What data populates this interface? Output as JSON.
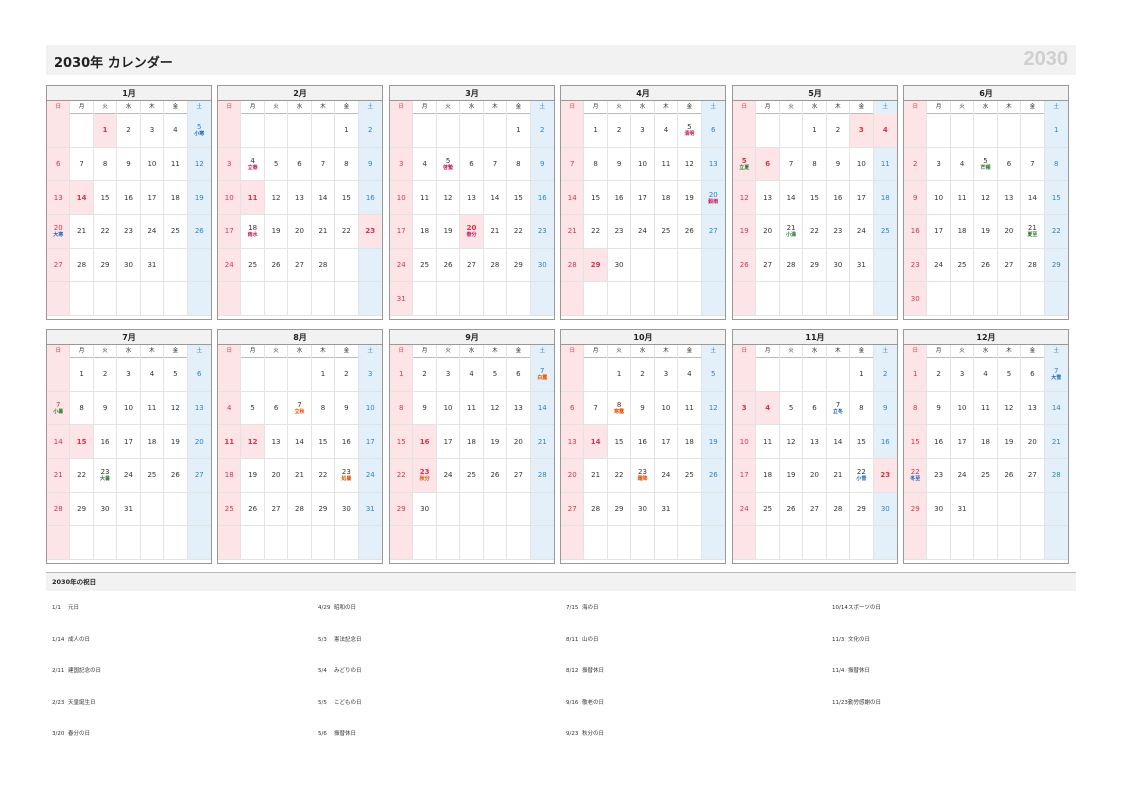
{
  "header": {
    "title": "2030年 カレンダー",
    "year_mark": "2030"
  },
  "weekdays": [
    "日",
    "月",
    "火",
    "水",
    "木",
    "金",
    "土"
  ],
  "colors": {
    "sunday": "#d6334a",
    "saturday": "#2a85c7",
    "holiday_bg": "#fde4e6",
    "saturday_bg": "#e3f0fa",
    "term_green": "#2e7d32",
    "term_orange": "#e65100",
    "term_blue": "#1565c0",
    "term_magenta": "#c2185b"
  },
  "months": [
    {
      "label": "1月",
      "start": 2,
      "days": 31,
      "holidays": [
        1,
        14
      ],
      "terms": {
        "5": {
          "t": "小寒",
          "c": "blue"
        },
        "20": {
          "t": "大寒",
          "c": "blue"
        }
      }
    },
    {
      "label": "2月",
      "start": 5,
      "days": 28,
      "holidays": [
        11,
        23
      ],
      "terms": {
        "4": {
          "t": "立春",
          "c": "magenta"
        },
        "18": {
          "t": "雨水",
          "c": "magenta"
        }
      }
    },
    {
      "label": "3月",
      "start": 5,
      "days": 31,
      "holidays": [
        20
      ],
      "terms": {
        "5": {
          "t": "啓蟄",
          "c": "magenta"
        },
        "20": {
          "t": "春分",
          "c": "magenta"
        }
      }
    },
    {
      "label": "4月",
      "start": 1,
      "days": 30,
      "holidays": [
        29
      ],
      "terms": {
        "5": {
          "t": "清明",
          "c": "magenta"
        },
        "20": {
          "t": "穀雨",
          "c": "magenta"
        }
      }
    },
    {
      "label": "5月",
      "start": 3,
      "days": 31,
      "holidays": [
        3,
        4,
        5,
        6
      ],
      "terms": {
        "5": {
          "t": "立夏",
          "c": "green"
        },
        "21": {
          "t": "小満",
          "c": "green"
        }
      }
    },
    {
      "label": "6月",
      "start": 6,
      "days": 30,
      "holidays": [],
      "terms": {
        "5": {
          "t": "芒種",
          "c": "green"
        },
        "21": {
          "t": "夏至",
          "c": "green"
        }
      }
    },
    {
      "label": "7月",
      "start": 1,
      "days": 31,
      "holidays": [
        15
      ],
      "terms": {
        "7": {
          "t": "小暑",
          "c": "green"
        },
        "23": {
          "t": "大暑",
          "c": "green"
        }
      }
    },
    {
      "label": "8月",
      "start": 4,
      "days": 31,
      "holidays": [
        11,
        12
      ],
      "terms": {
        "7": {
          "t": "立秋",
          "c": "orange"
        },
        "23": {
          "t": "処暑",
          "c": "orange"
        }
      }
    },
    {
      "label": "9月",
      "start": 0,
      "days": 30,
      "holidays": [
        16,
        23
      ],
      "terms": {
        "7": {
          "t": "白露",
          "c": "orange"
        },
        "23": {
          "t": "秋分",
          "c": "orange"
        }
      }
    },
    {
      "label": "10月",
      "start": 2,
      "days": 31,
      "holidays": [
        14
      ],
      "terms": {
        "8": {
          "t": "寒露",
          "c": "orange"
        },
        "23": {
          "t": "霜降",
          "c": "orange"
        }
      }
    },
    {
      "label": "11月",
      "start": 5,
      "days": 30,
      "holidays": [
        3,
        4,
        23
      ],
      "terms": {
        "7": {
          "t": "立冬",
          "c": "blue"
        },
        "22": {
          "t": "小雪",
          "c": "blue"
        }
      }
    },
    {
      "label": "12月",
      "start": 0,
      "days": 31,
      "holidays": [],
      "terms": {
        "7": {
          "t": "大雪",
          "c": "blue"
        },
        "22": {
          "t": "冬至",
          "c": "blue"
        }
      }
    }
  ],
  "holiday_list": {
    "title": "2030年の祝日",
    "items": [
      {
        "date": "1/1",
        "name": "元日"
      },
      {
        "date": "1/14",
        "name": "成人の日"
      },
      {
        "date": "2/11",
        "name": "建国記念の日"
      },
      {
        "date": "2/23",
        "name": "天皇誕生日"
      },
      {
        "date": "3/20",
        "name": "春分の日"
      },
      {
        "date": "4/29",
        "name": "昭和の日"
      },
      {
        "date": "5/3",
        "name": "憲法記念日"
      },
      {
        "date": "5/4",
        "name": "みどりの日"
      },
      {
        "date": "5/5",
        "name": "こどもの日"
      },
      {
        "date": "5/6",
        "name": "振替休日"
      },
      {
        "date": "7/15",
        "name": "海の日"
      },
      {
        "date": "8/11",
        "name": "山の日"
      },
      {
        "date": "8/12",
        "name": "振替休日"
      },
      {
        "date": "9/16",
        "name": "敬老の日"
      },
      {
        "date": "9/23",
        "name": "秋分の日"
      },
      {
        "date": "10/14",
        "name": "スポーツの日"
      },
      {
        "date": "11/3",
        "name": "文化の日"
      },
      {
        "date": "11/4",
        "name": "振替休日"
      },
      {
        "date": "11/23",
        "name": "勤労感謝の日"
      }
    ]
  }
}
